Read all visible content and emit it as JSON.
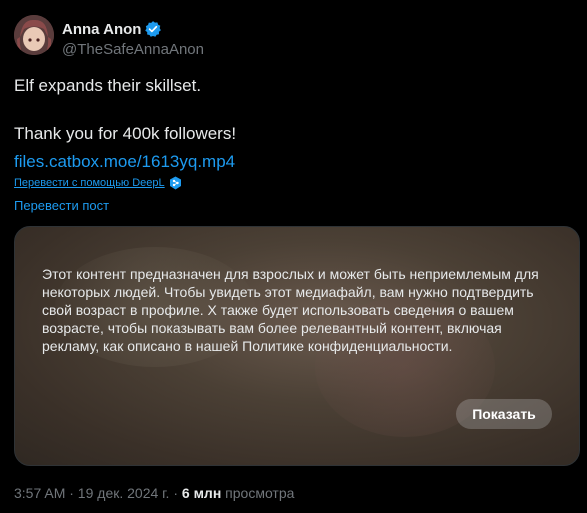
{
  "author": {
    "display_name": "Anna Anon",
    "handle": "@TheSafeAnnaAnon",
    "verified_icon": "verified-badge-icon",
    "more_icon": "more-options-icon"
  },
  "post": {
    "line1": "Elf expands their skillset.",
    "line2": "Thank you for 400k followers!",
    "link": "files.catbox.moe/1613yq.mp4"
  },
  "translation": {
    "deepl_label": "Перевести с помощью DeepL",
    "translate_post": "Перевести пост"
  },
  "media": {
    "warning_text": "Этот контент предназначен для взрослых и может быть неприемлемым для некоторых людей. Чтобы увидеть этот медиафайл, вам нужно подтвердить свой возраст в профиле. X также будет использовать сведения о вашем возрасте, чтобы показывать вам более релевантный контент, включая рекламу, как описано в нашей Политике конфиденциальности.",
    "show_button": "Показать"
  },
  "meta": {
    "timestamp": "3:57 AM · 19 дек. 2024 г. · ",
    "views_count": "6 млн",
    "views_label": " просмотра"
  },
  "colors": {
    "accent": "#1d9bf0",
    "background": "#000000",
    "text": "#e7e9ea",
    "muted": "#71767b"
  }
}
